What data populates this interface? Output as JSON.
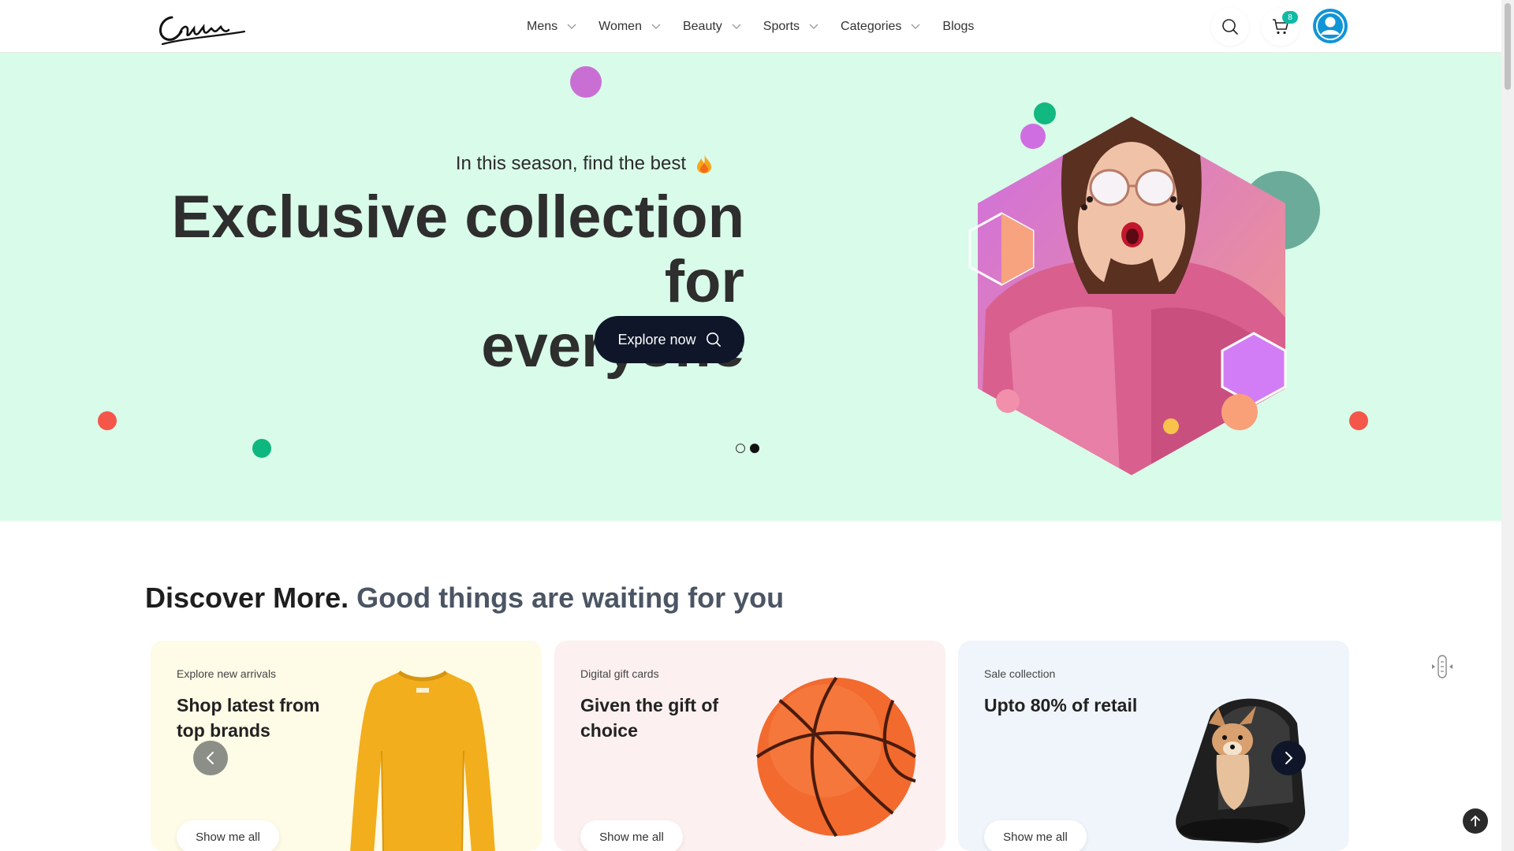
{
  "brand": {
    "logo_text": "Canim"
  },
  "nav": {
    "items": [
      {
        "label": "Mens",
        "has_dropdown": true
      },
      {
        "label": "Women",
        "has_dropdown": true
      },
      {
        "label": "Beauty",
        "has_dropdown": true
      },
      {
        "label": "Sports",
        "has_dropdown": true
      },
      {
        "label": "Categories",
        "has_dropdown": true
      },
      {
        "label": "Blogs",
        "has_dropdown": false
      }
    ]
  },
  "header_actions": {
    "search_icon": "search-icon",
    "cart_icon": "cart-icon",
    "cart_count": "8",
    "avatar_icon": "user-icon"
  },
  "hero": {
    "subtitle": "In this season, find the best",
    "subtitle_icon": "fire-icon",
    "title_line1": "Exclusive collection for",
    "title_line2": "everyone",
    "cta_label": "Explore now",
    "cta_icon": "search-icon",
    "slides_total": 2,
    "active_slide": 2
  },
  "discover": {
    "heading_strong": "Discover More.",
    "heading_sub": "Good things are waiting for you",
    "cards": [
      {
        "kicker": "Explore new arrivals",
        "title": "Shop latest from top brands",
        "button": "Show me all",
        "image": "yellow-sweater"
      },
      {
        "kicker": "Digital gift cards",
        "title": "Given the gift of choice",
        "button": "Show me all",
        "image": "basketball"
      },
      {
        "kicker": "Sale collection",
        "title": "Upto 80% of retail",
        "button": "Show me all",
        "image": "dog-in-carrier"
      }
    ]
  },
  "colors": {
    "hero_bg": "#d9fbe9",
    "dark_button": "#0f1629",
    "cart_badge": "#10b9a5",
    "avatar": "#1194d6",
    "card_1_bg": "#fefbe6",
    "card_2_bg": "#fdf0f0",
    "card_3_bg": "#eff5fb"
  }
}
